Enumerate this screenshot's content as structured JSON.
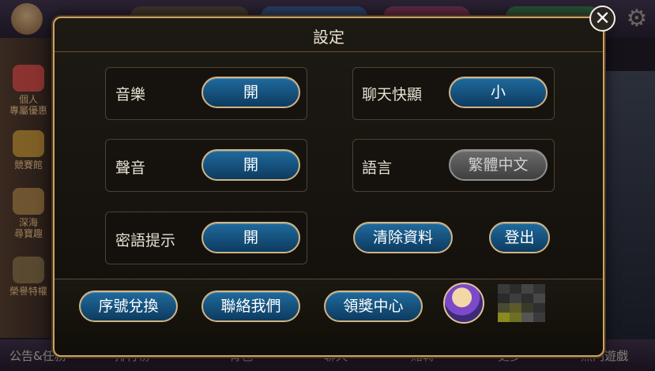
{
  "modal": {
    "title": "設定"
  },
  "settings": {
    "music": {
      "label": "音樂",
      "value": "開"
    },
    "sound": {
      "label": "聲音",
      "value": "開"
    },
    "password_hint": {
      "label": "密語提示",
      "value": "開"
    },
    "chat_popup": {
      "label": "聊天快顯",
      "value": "小"
    },
    "language": {
      "label": "語言",
      "value": "繁體中文"
    }
  },
  "actions": {
    "clear_data": "清除資料",
    "logout": "登出"
  },
  "footer": {
    "redeem_code": "序號兌換",
    "contact_us": "聯絡我們",
    "rewards_center": "領獎中心"
  },
  "background": {
    "sidebar": [
      "個人\n專屬優惠",
      "競賽館",
      "深海\n尋寶趣",
      "榮譽特權"
    ],
    "bottom_nav": [
      "公告&任務",
      "排行榜",
      "背包",
      "聊天",
      "賭轉",
      "更多",
      "熱門遊戲"
    ]
  },
  "colors": {
    "pill_blue": "#0d3b60",
    "pill_border": "#d2b483",
    "modal_border": "#c9a36a"
  },
  "icons": {
    "close": "close-icon",
    "settings": "gear-icon"
  }
}
